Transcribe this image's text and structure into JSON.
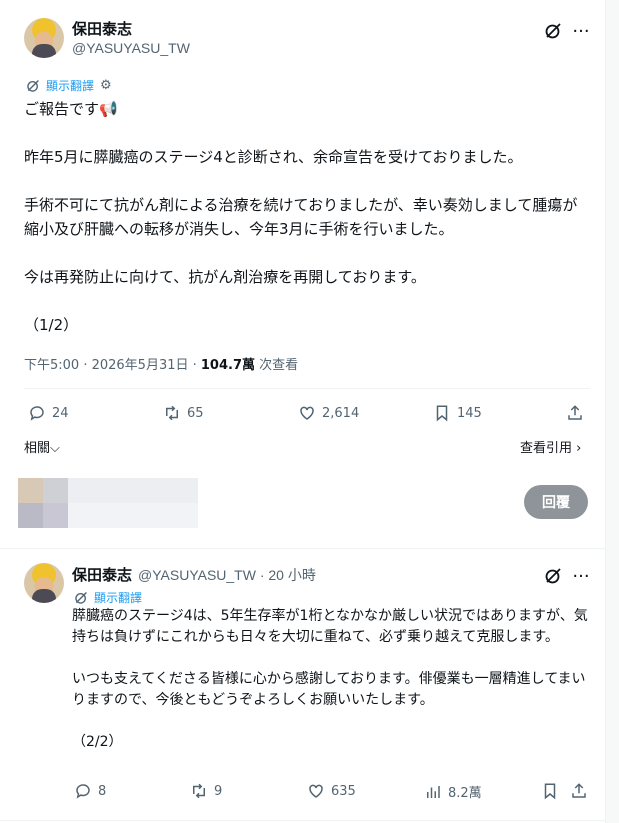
{
  "tweet": {
    "name": "保田泰志",
    "handle": "@YASUYASU_TW",
    "translate_label": "顯示翻譯",
    "body": "ご報告です📢\n\n昨年5月に膵臓癌のステージ4と診断され、余命宣告を受けておりました。\n\n手術不可にて抗がん剤による治療を続けておりましたが、幸い奏効しまして腫瘍が縮小及び肝臓への転移が消失し、今年3月に手術を行いました。\n\n今は再発防止に向けて、抗がん剤治療を再開しております。\n\n（1/2）",
    "timestamp": "下午5:00 · 2026年5月31日 · ",
    "views": "104.7萬",
    "views_label": " 次查看",
    "replies": "24",
    "retweets": "65",
    "likes": "2,614",
    "bookmarks": "145",
    "related_label": "相關⌵",
    "quotes_label": "查看引用 ›"
  },
  "reply_box": {
    "button_label": "回覆"
  },
  "reply": {
    "name": "保田泰志",
    "handle_time": "@YASUYASU_TW · 20 小時",
    "translate_label": "顯示翻譯",
    "body": "膵臓癌のステージ4は、5年生存率が1桁となかなか厳しい状況ではありますが、気持ちは負けずにこれからも日々を大切に重ねて、必ず乗り越えて克服します。\n\nいつも支えてくださる皆様に心から感謝しております。俳優業も一層精進してまいりますので、今後ともどうぞよろしくお願いいたします。\n\n（2/2）",
    "replies": "8",
    "retweets": "9",
    "likes": "635",
    "views": "8.2萬"
  },
  "colors": {
    "accent": "#1d9bf0",
    "muted": "#536471",
    "reply_button": "#8e9499"
  }
}
